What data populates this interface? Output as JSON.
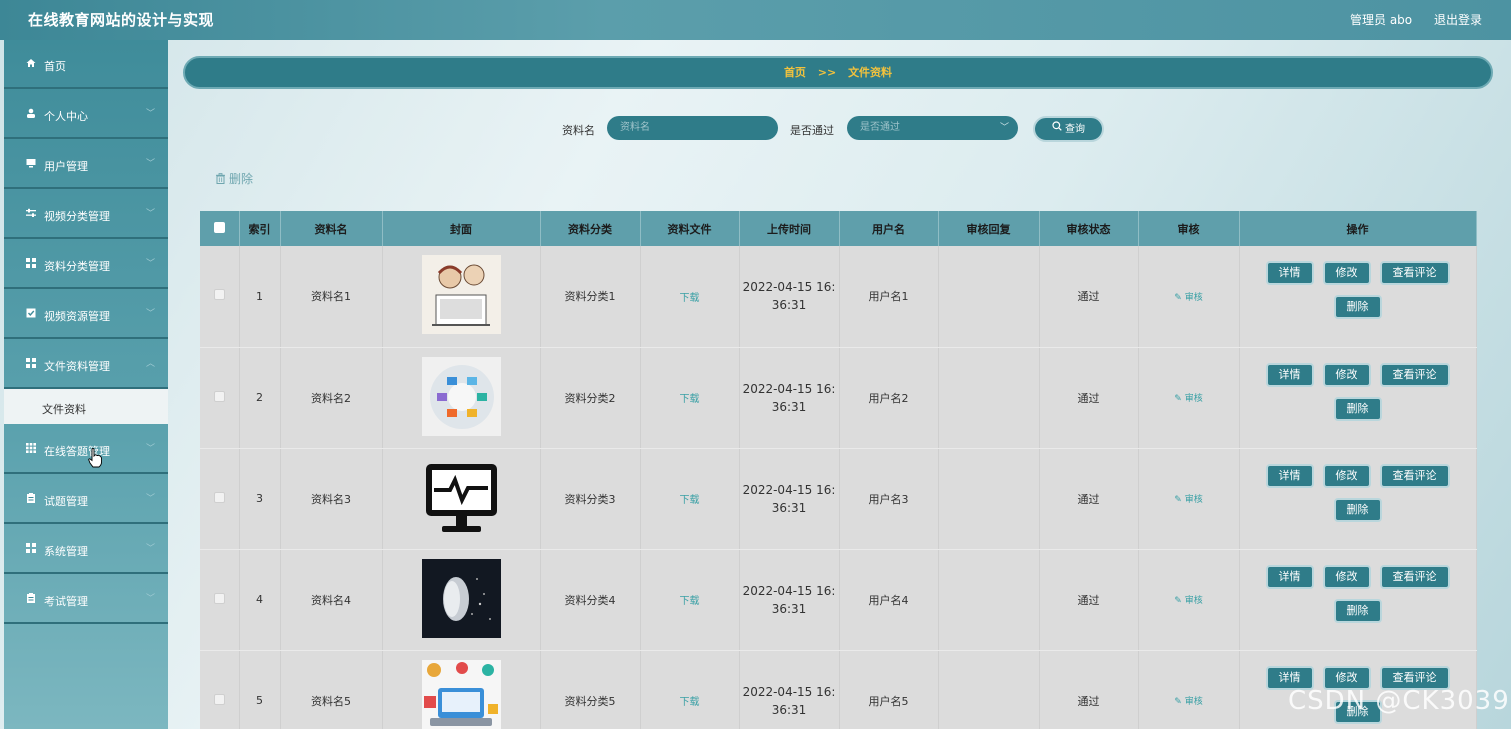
{
  "header": {
    "app_title": "在线教育网站的设计与实现",
    "admin_label": "管理员 abo",
    "logout_label": "退出登录"
  },
  "sidebar": {
    "items": [
      {
        "label": "首页",
        "icon": "home-icon"
      },
      {
        "label": "个人中心",
        "icon": "user-icon"
      },
      {
        "label": "用户管理",
        "icon": "monitor-icon"
      },
      {
        "label": "视频分类管理",
        "icon": "sliders-icon"
      },
      {
        "label": "资料分类管理",
        "icon": "grid-icon"
      },
      {
        "label": "视频资源管理",
        "icon": "checkbox-icon"
      },
      {
        "label": "文件资料管理",
        "icon": "grid-icon"
      },
      {
        "label": "在线答题管理",
        "icon": "grid-icon"
      },
      {
        "label": "试题管理",
        "icon": "clipboard-icon"
      },
      {
        "label": "系统管理",
        "icon": "grid-icon"
      },
      {
        "label": "考试管理",
        "icon": "clipboard-icon"
      }
    ],
    "sub_item": "文件资料"
  },
  "breadcrumb": {
    "home": "首页",
    "separator": ">>",
    "current": "文件资料"
  },
  "search": {
    "name_label": "资料名",
    "name_placeholder": "资料名",
    "status_label": "是否通过",
    "status_placeholder": "是否通过",
    "query_label": "查询"
  },
  "toolbar": {
    "delete_label": "删除"
  },
  "table": {
    "headers": [
      "索引",
      "资料名",
      "封面",
      "资料分类",
      "资料文件",
      "上传时间",
      "用户名",
      "审核回复",
      "审核状态",
      "审核",
      "操作"
    ],
    "download_label": "下载",
    "audit_label": "审核",
    "ops": {
      "detail": "详情",
      "edit": "修改",
      "comments": "查看评论",
      "delete": "删除"
    },
    "rows": [
      {
        "index": "1",
        "name": "资料名1",
        "category": "资料分类1",
        "time_line1": "2022-04-15 16:",
        "time_line2": "36:31",
        "user": "用户名1",
        "reply": "",
        "status": "通过"
      },
      {
        "index": "2",
        "name": "资料名2",
        "category": "资料分类2",
        "time_line1": "2022-04-15 16:",
        "time_line2": "36:31",
        "user": "用户名2",
        "reply": "",
        "status": "通过"
      },
      {
        "index": "3",
        "name": "资料名3",
        "category": "资料分类3",
        "time_line1": "2022-04-15 16:",
        "time_line2": "36:31",
        "user": "用户名3",
        "reply": "",
        "status": "通过"
      },
      {
        "index": "4",
        "name": "资料名4",
        "category": "资料分类4",
        "time_line1": "2022-04-15 16:",
        "time_line2": "36:31",
        "user": "用户名4",
        "reply": "",
        "status": "通过"
      },
      {
        "index": "5",
        "name": "资料名5",
        "category": "资料分类5",
        "time_line1": "2022-04-15 16:",
        "time_line2": "36:31",
        "user": "用户名5",
        "reply": "",
        "status": "通过"
      }
    ]
  },
  "watermark": "CSDN @CK3039",
  "colors": {
    "primary": "#2f7c89",
    "breadcrumb_text": "#f2c23d",
    "table_header": "#5f9fab",
    "link": "#39a0a5"
  }
}
